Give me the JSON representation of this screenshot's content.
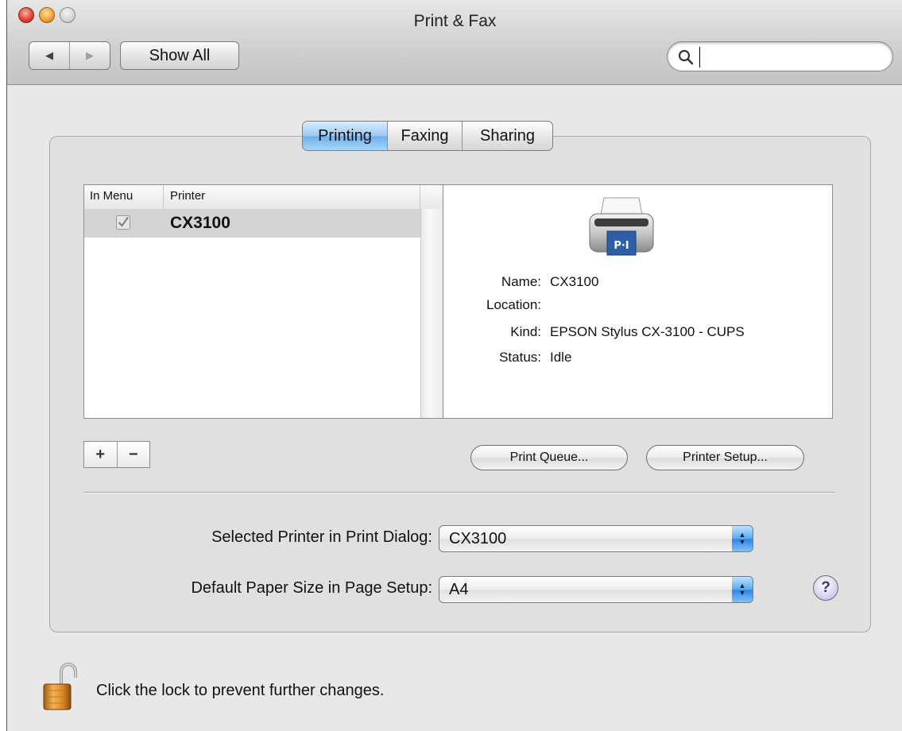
{
  "window": {
    "title": "Print & Fax"
  },
  "toolbar": {
    "back_icon": "back-arrow-icon",
    "forward_icon": "forward-arrow-icon",
    "show_all_label": "Show All",
    "search": {
      "value": "",
      "placeholder": ""
    }
  },
  "tabs": [
    {
      "label": "Printing",
      "active": true
    },
    {
      "label": "Faxing",
      "active": false
    },
    {
      "label": "Sharing",
      "active": false
    }
  ],
  "printer_list": {
    "columns": [
      "In Menu",
      "Printer"
    ],
    "rows": [
      {
        "in_menu": true,
        "printer": "CX3100",
        "selected": true
      }
    ]
  },
  "printer_info": {
    "icon": "printer-icon",
    "fields": [
      {
        "label": "Name:",
        "value": "CX3100"
      },
      {
        "label": "Location:",
        "value": ""
      },
      {
        "label": "Kind:",
        "value": "EPSON Stylus CX-3100 - CUPS"
      },
      {
        "label": "Status:",
        "value": "Idle"
      }
    ]
  },
  "list_buttons": {
    "add": "+",
    "remove": "−"
  },
  "buttons": {
    "print_queue": "Print Queue...",
    "printer_setup": "Printer Setup..."
  },
  "settings": {
    "selected_printer_label": "Selected Printer in Print Dialog:",
    "selected_printer_value": "CX3100",
    "paper_size_label": "Default Paper Size in Page Setup:",
    "paper_size_value": "A4"
  },
  "help_label": "?",
  "lock": {
    "text": "Click the lock to prevent further changes.",
    "state": "unlocked"
  },
  "colors": {
    "active_tab": "#8ec4f2",
    "popup_arrows": "#3a8ee2",
    "selection_row": "#d4d4d4"
  }
}
